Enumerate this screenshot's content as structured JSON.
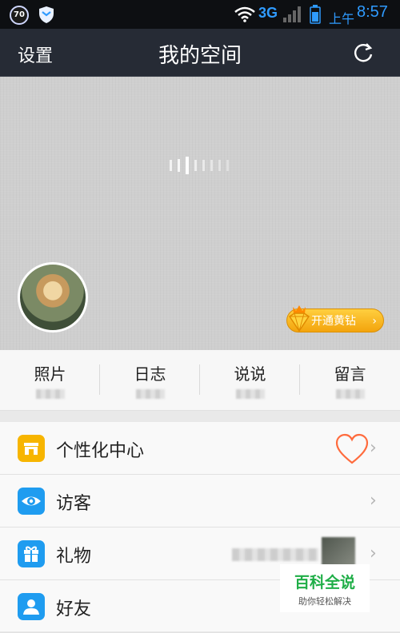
{
  "status_bar": {
    "badge": "70",
    "network": "3G",
    "ampm": "上午",
    "time": "8:57"
  },
  "title_bar": {
    "settings_label": "设置",
    "title": "我的空间"
  },
  "vip": {
    "label": "开通黄钻"
  },
  "stats": [
    {
      "label": "照片"
    },
    {
      "label": "日志"
    },
    {
      "label": "说说"
    },
    {
      "label": "留言"
    }
  ],
  "menu": [
    {
      "label": "个性化中心",
      "icon": "shop-icon",
      "color": "#f7b500"
    },
    {
      "label": "访客",
      "icon": "eye-icon",
      "color": "#1f9cf0"
    },
    {
      "label": "礼物",
      "icon": "gift-icon",
      "color": "#1f9cf0"
    },
    {
      "label": "好友",
      "icon": "friend-icon",
      "color": "#1f9cf0"
    }
  ],
  "watermark": {
    "title": "百科全说",
    "subtitle": "助你轻松解决"
  },
  "colors": {
    "title_bar": "#262b35",
    "status_accent": "#2f9bff",
    "vip_gold": "#f3a40d",
    "heart": "#ff6b3d"
  }
}
